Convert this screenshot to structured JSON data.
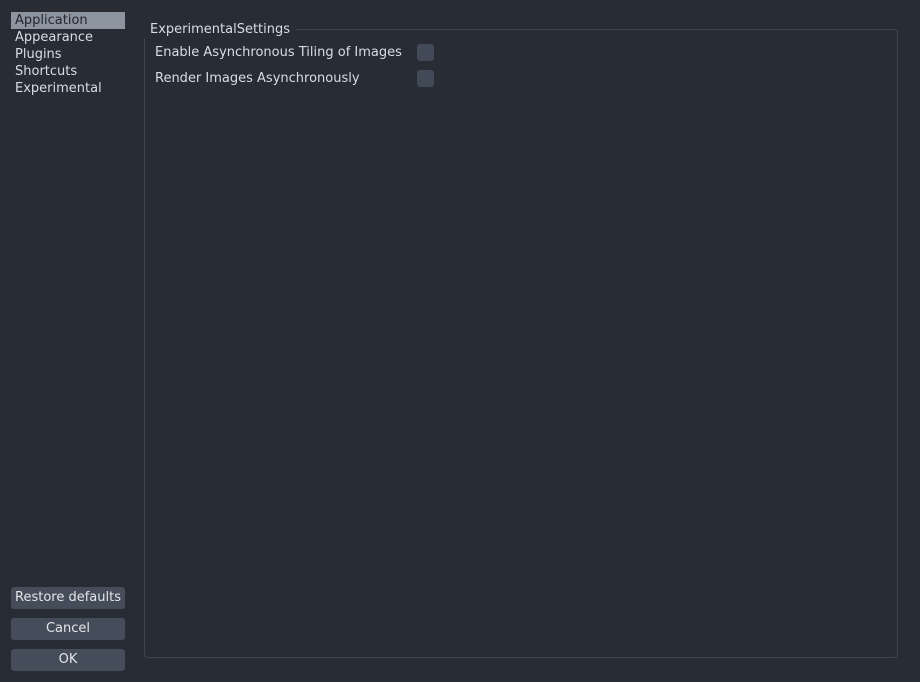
{
  "sidebar": {
    "categories": [
      {
        "label": "Application",
        "selected": true
      },
      {
        "label": "Appearance",
        "selected": false
      },
      {
        "label": "Plugins",
        "selected": false
      },
      {
        "label": "Shortcuts",
        "selected": false
      },
      {
        "label": "Experimental",
        "selected": false
      }
    ],
    "buttons": [
      {
        "label": "Restore defaults",
        "name": "restore-defaults-button"
      },
      {
        "label": "Cancel",
        "name": "cancel-button"
      },
      {
        "label": "OK",
        "name": "ok-button"
      }
    ]
  },
  "panel": {
    "group_title": "ExperimentalSettings",
    "settings": [
      {
        "label": "Enable Asynchronous Tiling of Images",
        "checked": false
      },
      {
        "label": "Render Images Asynchronously",
        "checked": false
      }
    ]
  },
  "colors": {
    "background": "#272c35",
    "panel_border": "#3d4450",
    "selection": "#8c94a0",
    "selection_text": "#22262e",
    "button_fill": "#454d5a",
    "checkbox_fill": "#434a57",
    "text": "#d9dde3"
  }
}
